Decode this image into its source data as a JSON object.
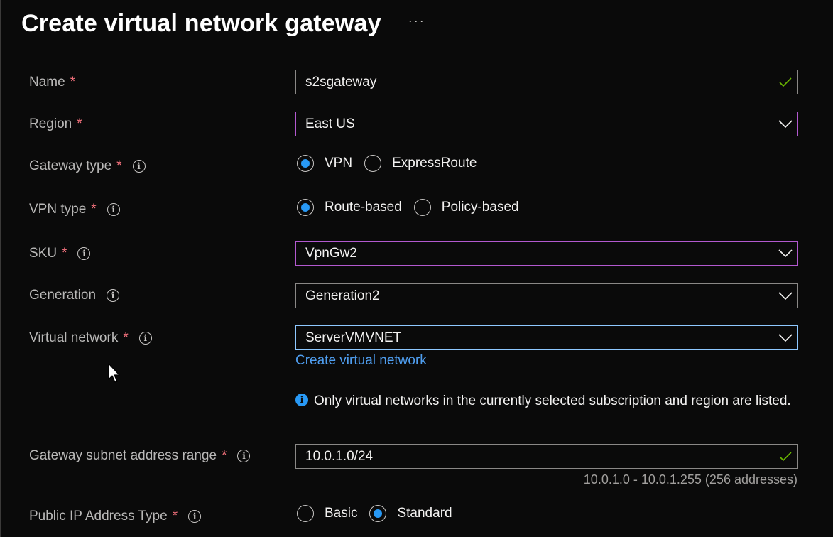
{
  "page": {
    "title": "Create virtual network gateway",
    "more_label": "···"
  },
  "form": {
    "name": {
      "label": "Name",
      "required": "*",
      "value": "s2sgateway"
    },
    "region": {
      "label": "Region",
      "required": "*",
      "value": "East US"
    },
    "gateway_type": {
      "label": "Gateway type",
      "required": "*",
      "options": [
        "VPN",
        "ExpressRoute"
      ],
      "selected": "VPN"
    },
    "vpn_type": {
      "label": "VPN type",
      "required": "*",
      "options": [
        "Route-based",
        "Policy-based"
      ],
      "selected": "Route-based"
    },
    "sku": {
      "label": "SKU",
      "required": "*",
      "value": "VpnGw2"
    },
    "generation": {
      "label": "Generation",
      "value": "Generation2"
    },
    "virtual_network": {
      "label": "Virtual network",
      "required": "*",
      "value": "ServerVMVNET",
      "create_link": "Create virtual network",
      "note": "Only virtual networks in the currently selected subscription and region are listed."
    },
    "gateway_subnet": {
      "label": "Gateway subnet address range",
      "required": "*",
      "value": "10.0.1.0/24",
      "hint": "10.0.1.0 - 10.0.1.255 (256 addresses)"
    },
    "public_ip_type": {
      "label": "Public IP Address Type",
      "required": "*",
      "options": [
        "Basic",
        "Standard"
      ],
      "selected": "Standard"
    }
  },
  "icons": {
    "info": "info-icon",
    "chevron": "chevron-down-icon",
    "check": "checkmark-icon",
    "cursor": "mouse-pointer-icon"
  },
  "colors": {
    "required": "#f1707b",
    "radio_selected": "#2899f5",
    "link": "#4f9ef0",
    "valid_check": "#6bb700",
    "focused_border": "#b259cf"
  }
}
